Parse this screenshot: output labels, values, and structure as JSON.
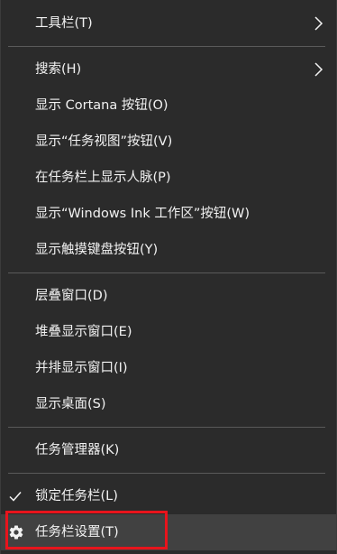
{
  "menu": {
    "items": [
      {
        "label": "工具栏(T)"
      },
      {
        "label": "搜索(H)"
      },
      {
        "label": "显示 Cortana 按钮(O)"
      },
      {
        "label": "显示“任务视图”按钮(V)"
      },
      {
        "label": "在任务栏上显示人脉(P)"
      },
      {
        "label": "显示“Windows Ink 工作区”按钮(W)"
      },
      {
        "label": "显示触摸键盘按钮(Y)"
      },
      {
        "label": "层叠窗口(D)"
      },
      {
        "label": "堆叠显示窗口(E)"
      },
      {
        "label": "并排显示窗口(I)"
      },
      {
        "label": "显示桌面(S)"
      },
      {
        "label": "任务管理器(K)"
      },
      {
        "label": "锁定任务栏(L)",
        "checked": true
      },
      {
        "label": "任务栏设置(T)",
        "icon": "gear-icon",
        "hovered": true
      }
    ]
  },
  "colors": {
    "background": "#2b2b2b",
    "text": "#f2f2f2",
    "separator": "#5a5a5a",
    "hover": "#414141",
    "annotation": "#e8141c"
  }
}
